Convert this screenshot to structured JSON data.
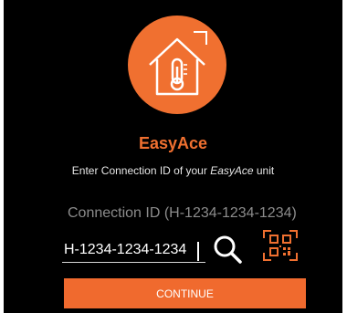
{
  "app": {
    "brand": "EasyAce",
    "subtitle_prefix": "Enter Connection ID of your ",
    "subtitle_brand": "EasyAce",
    "subtitle_suffix": " unit"
  },
  "form": {
    "hint": "Connection ID (H-1234-1234-1234)",
    "connection_id_value": "H-1234-1234-1234",
    "continue_label": "CONTINUE"
  },
  "icons": {
    "logo": "house-thermometer-icon",
    "search": "search-icon",
    "qr": "qr-code-scan-icon"
  },
  "colors": {
    "accent": "#f06a2e",
    "background": "#000000",
    "text": "#ffffff",
    "hint": "#8c8c8c"
  }
}
